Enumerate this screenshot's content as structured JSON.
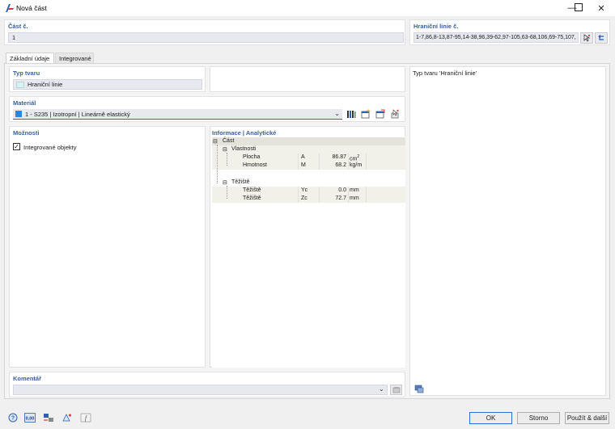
{
  "window": {
    "title": "Nová část",
    "min_glyph": "—",
    "max_glyph": "☐",
    "close_glyph": "✕"
  },
  "part_no": {
    "label": "Část č.",
    "value": "1"
  },
  "boundary": {
    "label": "Hraniční linie č.",
    "value": "1-7,86,8-13,87-95,14-38,96,39-62,97-105,63-68,106,69-75,107,"
  },
  "tabs": [
    {
      "label": "Základní údaje",
      "active": true
    },
    {
      "label": "Integrované",
      "active": false
    }
  ],
  "shape": {
    "label": "Typ tvaru",
    "value": "Hraniční linie",
    "swatch": "#d6f2f4"
  },
  "material": {
    "label": "Materiál",
    "value": "1 - S235 | Izotropní | Lineárně elastický",
    "swatch": "#2f86d6"
  },
  "options": {
    "label": "Možnosti",
    "checkbox_label": "Integrované objekty",
    "checked": true
  },
  "info": {
    "label": "Informace | Analytické",
    "root": "Část",
    "groups": [
      {
        "name": "Vlastnosti",
        "rows": [
          {
            "name": "Plocha",
            "symbol": "A",
            "value": "86.87",
            "unit": "cm",
            "unit_sup": "2"
          },
          {
            "name": "Hmotnost",
            "symbol": "M",
            "value": "68.2",
            "unit": "kg/m",
            "unit_sup": ""
          }
        ]
      },
      {
        "name": "Těžiště",
        "rows": [
          {
            "name": "Těžiště",
            "symbol": "Yc",
            "value": "0.0",
            "unit": "mm",
            "unit_sup": ""
          },
          {
            "name": "Těžiště",
            "symbol": "Zc",
            "value": "72.7",
            "unit": "mm",
            "unit_sup": ""
          }
        ]
      }
    ]
  },
  "preview": {
    "caption": "Typ tvaru 'Hraniční linie'"
  },
  "comment": {
    "label": "Komentář",
    "value": ""
  },
  "footer": {
    "ok": "OK",
    "cancel": "Storno",
    "apply_next": "Použít & další"
  },
  "footer_tools": [
    {
      "name": "help-icon",
      "glyph": "?"
    },
    {
      "name": "units-icon",
      "glyph": "0,00"
    },
    {
      "name": "model-icon",
      "glyph": "⊞"
    },
    {
      "name": "section-icon",
      "glyph": "⊿"
    },
    {
      "name": "script-icon",
      "glyph": "ƒ"
    }
  ],
  "colors": {
    "accent": "#3a5f9a",
    "field_bg": "#e8e8ef",
    "focus_line": "#3a63b8",
    "tree_shade": "#f1f1ea"
  }
}
